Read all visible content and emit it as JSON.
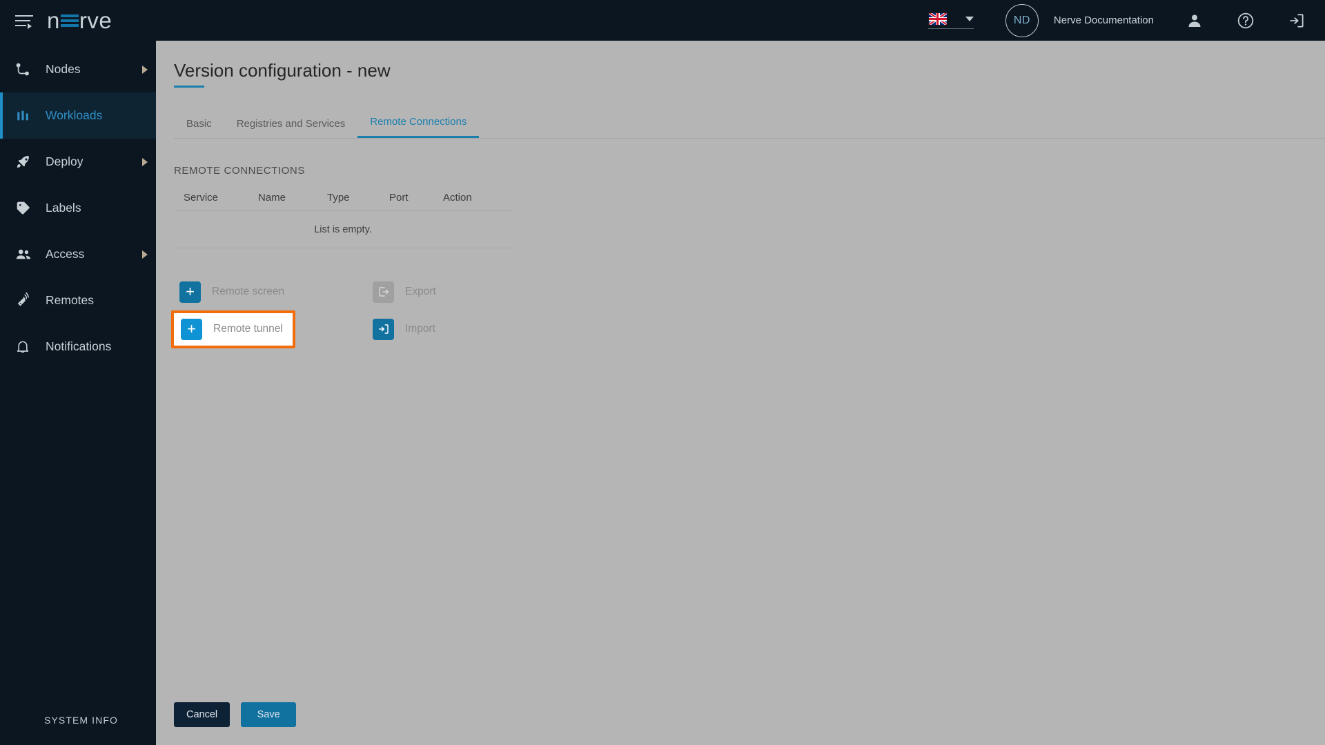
{
  "header": {
    "menu_icon": "hamburger-icon",
    "logo_text": "nerve",
    "language": {
      "flag": "uk-flag-icon",
      "caret": "chevron-down-icon"
    },
    "avatar_initials": "ND",
    "account_name": "Nerve Documentation",
    "icons": [
      "user-icon",
      "help-icon",
      "logout-icon"
    ]
  },
  "sidebar": {
    "items": [
      {
        "label": "Nodes",
        "icon": "nodes-icon",
        "active": false,
        "has_arrow": true
      },
      {
        "label": "Workloads",
        "icon": "workloads-icon",
        "active": true,
        "has_arrow": false
      },
      {
        "label": "Deploy",
        "icon": "deploy-rocket-icon",
        "active": false,
        "has_arrow": true
      },
      {
        "label": "Labels",
        "icon": "labels-tag-icon",
        "active": false,
        "has_arrow": false
      },
      {
        "label": "Access",
        "icon": "access-users-icon",
        "active": false,
        "has_arrow": true
      },
      {
        "label": "Remotes",
        "icon": "remotes-icon",
        "active": false,
        "has_arrow": false
      },
      {
        "label": "Notifications",
        "icon": "bell-icon",
        "active": false,
        "has_arrow": false
      }
    ],
    "system_info": "SYSTEM INFO"
  },
  "main": {
    "title": "Version configuration - new",
    "tabs": [
      {
        "label": "Basic",
        "active": false
      },
      {
        "label": "Registries and Services",
        "active": false
      },
      {
        "label": "Remote Connections",
        "active": true
      }
    ],
    "section_title": "REMOTE CONNECTIONS",
    "table": {
      "columns": [
        "Service",
        "Name",
        "Type",
        "Port",
        "Action"
      ],
      "rows": [],
      "empty_text": "List is empty."
    },
    "actions": [
      {
        "label": "Remote screen",
        "icon": "plus-icon",
        "style": "blue",
        "highlighted": false
      },
      {
        "label": "Export",
        "icon": "export-icon",
        "style": "grey",
        "highlighted": false
      },
      {
        "label": "Remote tunnel",
        "icon": "plus-icon",
        "style": "bright",
        "highlighted": true
      },
      {
        "label": "Import",
        "icon": "import-icon",
        "style": "blue",
        "highlighted": false
      }
    ],
    "footer": {
      "cancel_label": "Cancel",
      "save_label": "Save"
    }
  },
  "colors": {
    "accent": "#1b7fae",
    "highlight": "#f36c0a",
    "sidebar_bg": "#0b1620",
    "content_bg": "#b5b5b5"
  }
}
